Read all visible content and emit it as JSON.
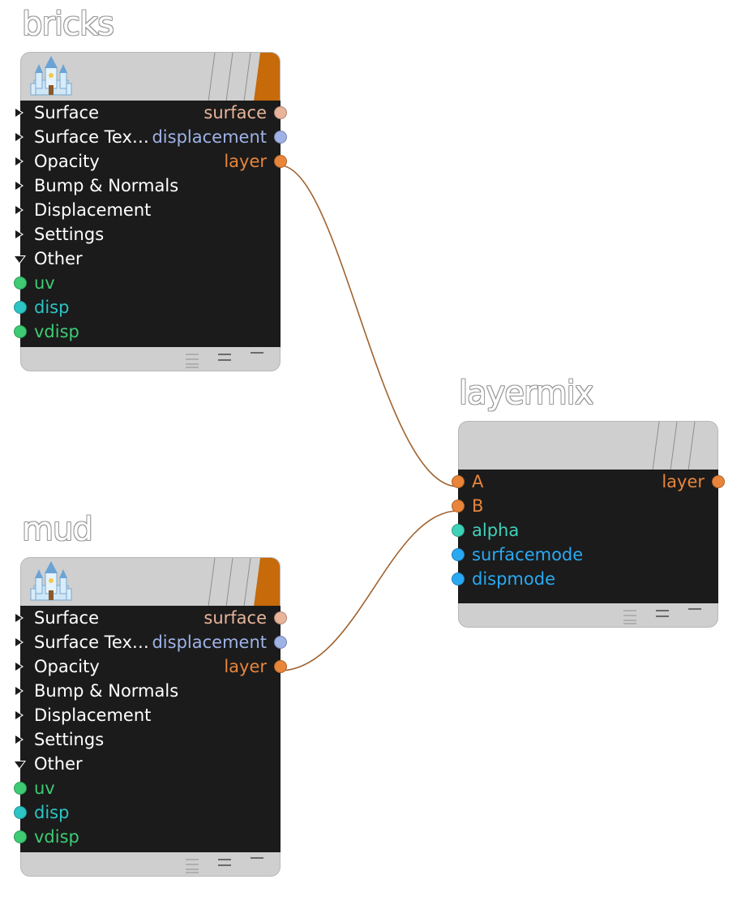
{
  "colors": {
    "surface": "#e8b49a",
    "displacement": "#9fb2e6",
    "layer": "#e8853a",
    "uv": "#3ecb74",
    "disp": "#2cc4c4",
    "vdisp": "#3ecb74",
    "alpha": "#3fd2b8",
    "surfacemode": "#2aa9f2",
    "dispmode": "#2aa9f2",
    "in_label": "#ffffff",
    "wire": "#a0622e",
    "header_flag": "#c66a0a"
  },
  "icons": {
    "header_icon": "castle-icon",
    "footer_icons": [
      "collapse-all-icon",
      "collapse-partial-icon",
      "minimize-icon"
    ]
  },
  "nodes": {
    "bricks": {
      "title": "bricks",
      "rows": [
        {
          "in": "Surface",
          "out": "surface",
          "expander": "closed"
        },
        {
          "in": "Surface Tex…",
          "out": "displacement",
          "expander": "closed"
        },
        {
          "in": "Opacity",
          "out": "layer",
          "expander": "closed"
        },
        {
          "in": "Bump & Normals",
          "expander": "closed"
        },
        {
          "in": "Displacement",
          "expander": "closed"
        },
        {
          "in": "Settings",
          "expander": "closed"
        },
        {
          "in": "Other",
          "expander": "open"
        },
        {
          "in": "uv"
        },
        {
          "in": "disp"
        },
        {
          "in": "vdisp"
        }
      ]
    },
    "mud": {
      "title": "mud",
      "rows": [
        {
          "in": "Surface",
          "out": "surface",
          "expander": "closed"
        },
        {
          "in": "Surface Tex…",
          "out": "displacement",
          "expander": "closed"
        },
        {
          "in": "Opacity",
          "out": "layer",
          "expander": "closed"
        },
        {
          "in": "Bump & Normals",
          "expander": "closed"
        },
        {
          "in": "Displacement",
          "expander": "closed"
        },
        {
          "in": "Settings",
          "expander": "closed"
        },
        {
          "in": "Other",
          "expander": "open"
        },
        {
          "in": "uv"
        },
        {
          "in": "disp"
        },
        {
          "in": "vdisp"
        }
      ]
    },
    "layermix": {
      "title": "layermix",
      "rows": [
        {
          "in": "A",
          "out": "layer"
        },
        {
          "in": "B"
        },
        {
          "in": "alpha"
        },
        {
          "in": "surfacemode"
        },
        {
          "in": "dispmode"
        }
      ]
    }
  },
  "connections": [
    {
      "from": "bricks.layer",
      "to": "layermix.A"
    },
    {
      "from": "mud.layer",
      "to": "layermix.B"
    }
  ]
}
